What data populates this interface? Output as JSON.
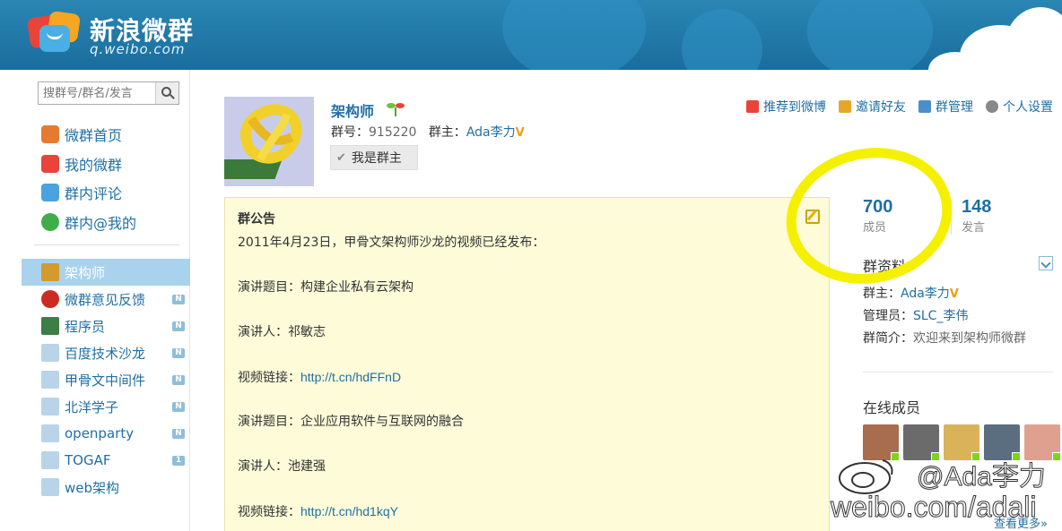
{
  "brand": {
    "name_cn": "新浪微群",
    "domain": "q.weibo.com"
  },
  "search": {
    "placeholder": "搜群号/群名/发言"
  },
  "nav": [
    {
      "label": "微群首页",
      "icon": "home-icon",
      "color": "#e57b2f"
    },
    {
      "label": "我的微群",
      "icon": "my-groups-icon",
      "color": "#e9433a"
    },
    {
      "label": "群内评论",
      "icon": "comment-icon",
      "color": "#4aa3df"
    },
    {
      "label": "群内@我的",
      "icon": "at-icon",
      "color": "#3fae49"
    }
  ],
  "groups": [
    {
      "label": "架构师",
      "active": true,
      "badge": "",
      "color": "#d49a2c"
    },
    {
      "label": "微群意见反馈",
      "active": false,
      "badge": "N",
      "color": "#cc2b22"
    },
    {
      "label": "程序员",
      "active": false,
      "badge": "N",
      "color": "#3d7d46"
    },
    {
      "label": "百度技术沙龙",
      "active": false,
      "badge": "N",
      "color": "#b9d4e8"
    },
    {
      "label": "甲骨文中间件",
      "active": false,
      "badge": "N",
      "color": "#b9d4e8"
    },
    {
      "label": "北洋学子",
      "active": false,
      "badge": "N",
      "color": "#b9d4e8"
    },
    {
      "label": "openparty",
      "active": false,
      "badge": "N",
      "color": "#b9d4e8"
    },
    {
      "label": "TOGAF",
      "active": false,
      "badge": "1",
      "color": "#b9d4e8"
    },
    {
      "label": "web架构",
      "active": false,
      "badge": "",
      "color": "#b9d4e8"
    }
  ],
  "group": {
    "name": "架构师",
    "id_label": "群号：",
    "id": "915220",
    "owner_label": "群主：",
    "owner": "Ada李力",
    "verified_mark": "V",
    "owner_button": "我是群主"
  },
  "actions": [
    {
      "label": "推荐到微博",
      "icon": "share-weibo-icon",
      "color": "#e9433a"
    },
    {
      "label": "邀请好友",
      "icon": "invite-friend-icon",
      "color": "#e8a629"
    },
    {
      "label": "群管理",
      "icon": "wrench-icon",
      "color": "#4a8fc9"
    },
    {
      "label": "个人设置",
      "icon": "gear-icon",
      "color": "#888888"
    }
  ],
  "notice": {
    "title": "群公告",
    "lines": [
      {
        "text": "2011年4月23日，甲骨文架构师沙龙的视频已经发布：",
        "link": ""
      },
      {
        "text": "",
        "link": ""
      },
      {
        "text": "演讲题目：构建企业私有云架构",
        "link": ""
      },
      {
        "text": "",
        "link": ""
      },
      {
        "text": "演讲人：祁敏志",
        "link": ""
      },
      {
        "text": "",
        "link": ""
      },
      {
        "text": "视频链接：",
        "link": "http://t.cn/hdFFnD"
      },
      {
        "text": "",
        "link": ""
      },
      {
        "text": "演讲题目：企业应用软件与互联网的融合",
        "link": ""
      },
      {
        "text": "",
        "link": ""
      },
      {
        "text": "演讲人：池建强",
        "link": ""
      },
      {
        "text": "",
        "link": ""
      },
      {
        "text": "视频链接：",
        "link": "http://t.cn/hd1kqY"
      }
    ]
  },
  "stats": {
    "members": "700",
    "members_label": "成员",
    "posts": "148",
    "posts_label": "发言"
  },
  "profile": {
    "title": "群资料",
    "owner_label": "群主：",
    "owner": "Ada李力",
    "admin_label": "管理员：",
    "admin": "SLC_李伟",
    "intro_label": "群简介：",
    "intro": "欢迎来到架构师微群"
  },
  "online": {
    "title": "在线成员",
    "members": [
      "#a86d4f",
      "#6b6b6b",
      "#d9b25a",
      "#5a6e80",
      "#e0a090"
    ]
  },
  "more_label": "查看更多»",
  "watermark": {
    "handle": "@Ada李力",
    "url": "weibo.com/adali"
  },
  "colors": {
    "link": "#1f6fa3",
    "highlight": "#f5f000",
    "header": "#1a6d9c"
  }
}
